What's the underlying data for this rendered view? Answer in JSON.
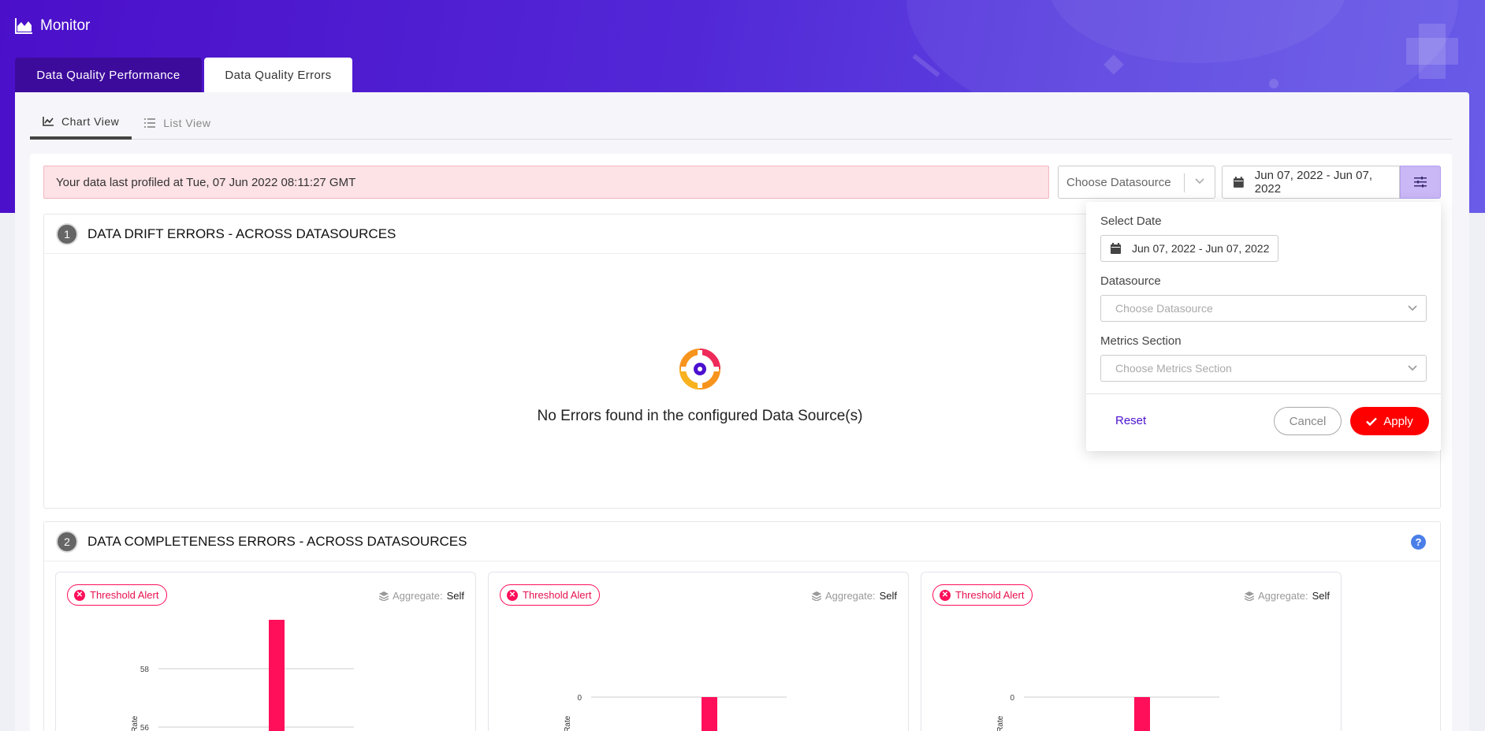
{
  "app": {
    "title": "Monitor"
  },
  "main_tabs": [
    {
      "label": "Data Quality Performance"
    },
    {
      "label": "Data Quality Errors"
    }
  ],
  "view_tabs": [
    {
      "label": "Chart View"
    },
    {
      "label": "List View"
    }
  ],
  "alert": {
    "text": "Your data last profiled at Tue, 07 Jun 2022 08:11:27 GMT"
  },
  "filters": {
    "datasource_placeholder": "Choose Datasource",
    "date_range": "Jun 07, 2022 - Jun 07, 2022"
  },
  "section1": {
    "number": "1",
    "title": "DATA DRIFT ERRORS - ACROSS DATASOURCES",
    "empty_text": "No Errors found in the configured Data Source(s)"
  },
  "section2": {
    "number": "2",
    "title": "DATA COMPLETENESS ERRORS - ACROSS DATASOURCES",
    "help": "?"
  },
  "mini_cards": [
    {
      "badge": "Threshold Alert",
      "agg_label": "Aggregate:",
      "agg_value": "Self"
    },
    {
      "badge": "Threshold Alert",
      "agg_label": "Aggregate:",
      "agg_value": "Self"
    },
    {
      "badge": "Threshold Alert",
      "agg_label": "Aggregate:",
      "agg_value": "Self"
    }
  ],
  "popover": {
    "select_date_label": "Select Date",
    "date_value": "Jun 07, 2022 - Jun 07, 2022",
    "datasource_label": "Datasource",
    "datasource_placeholder": "Choose Datasource",
    "metrics_label": "Metrics Section",
    "metrics_placeholder": "Choose Metrics Section",
    "reset": "Reset",
    "cancel": "Cancel",
    "apply": "Apply"
  },
  "chart_data": [
    {
      "type": "bar",
      "ylabel": "Fill Rate",
      "y_ticks": [
        "58",
        "56"
      ],
      "bar_color": "#ff0f5a"
    },
    {
      "type": "bar",
      "ylabel": "Fill Rate",
      "y_ticks": [
        "0"
      ],
      "bar_color": "#ff0f5a"
    },
    {
      "type": "bar",
      "ylabel": "Fill Rate",
      "y_ticks": [
        "0"
      ],
      "bar_color": "#ff0f5a"
    }
  ],
  "colors": {
    "primary": "#4b10d0",
    "danger": "#ff0f5a",
    "apply": "#ff0000"
  }
}
